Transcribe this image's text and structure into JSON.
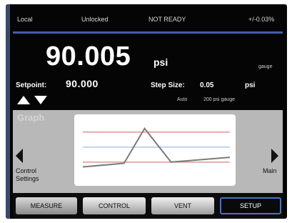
{
  "status": {
    "mode": "Local",
    "lock": "Unlocked",
    "ready": "NOT READY",
    "accuracy": "+/-0.03%"
  },
  "reading": {
    "value": "90.005",
    "unit": "psi",
    "mode": "gauge"
  },
  "setpoint": {
    "label": "Setpoint:",
    "value": "90.000"
  },
  "step": {
    "label": "Step Size:",
    "value": "0.05",
    "unit": "psi"
  },
  "range": {
    "auto_label": "Auto",
    "value": "200 psi gauge"
  },
  "graph": {
    "title": "Graph",
    "left_nav_label": "Control Settings",
    "right_nav_label": "Main",
    "colors": {
      "upper_limit": "#e08a8a",
      "lower_limit": "#e08a8a",
      "setpoint_line": "#9ec4ea",
      "trace": "#7a7a7a"
    }
  },
  "chart_data": {
    "type": "line",
    "series": [
      {
        "values": [
          0.22,
          0.28,
          0.86,
          0.3,
          0.38
        ]
      }
    ],
    "reference_lines": [
      0.8,
      0.55,
      0.3
    ],
    "grid": false
  },
  "buttons": {
    "measure": "MEASURE",
    "control": "CONTROL",
    "vent": "VENT",
    "setup": "SETUP"
  },
  "colors": {
    "accent": "#4a6fd0",
    "status_line": "#3f5fa8"
  }
}
